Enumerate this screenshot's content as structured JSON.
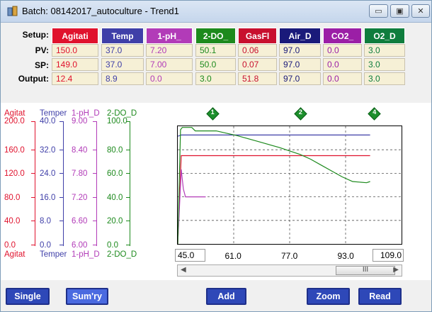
{
  "window": {
    "title": "Batch: 08142017_autoculture - Trend1"
  },
  "setup": {
    "row_labels": {
      "setup": "Setup:",
      "pv": "PV:",
      "sp": "SP:",
      "output": "Output:"
    },
    "columns": [
      {
        "label": "Agitati",
        "color": "#e0122d",
        "pv": "150.0",
        "sp": "149.0",
        "output": "12.4"
      },
      {
        "label": "Temp",
        "color": "#3f3fa8",
        "pv": "37.0",
        "sp": "37.0",
        "output": "8.9"
      },
      {
        "label": "1-pH_",
        "color": "#b23bb8",
        "pv": "7.20",
        "sp": "7.00",
        "output": "0.0"
      },
      {
        "label": "2-DO_",
        "color": "#1d8a1d",
        "pv": "50.1",
        "sp": "50.0",
        "output": "3.0"
      },
      {
        "label": "GasFl",
        "color": "#c8102e",
        "pv": "0.06",
        "sp": "0.07",
        "output": "51.8"
      },
      {
        "label": "Air_D",
        "color": "#1a1a7a",
        "pv": "97.0",
        "sp": "97.0",
        "output": "97.0"
      },
      {
        "label": "CO2_",
        "color": "#9b1fa6",
        "pv": "0.0",
        "sp": "0.0",
        "output": "0.0"
      },
      {
        "label": "O2_D",
        "color": "#0f7d3d",
        "pv": "3.0",
        "sp": "3.0",
        "output": "3.0"
      }
    ]
  },
  "chart_data": {
    "type": "line",
    "axes": [
      {
        "name": "Agitat",
        "color": "#e0122d",
        "ticks": [
          "200.0",
          "160.0",
          "120.0",
          "80.0",
          "40.0",
          "0.0"
        ],
        "ylim": [
          0,
          200
        ]
      },
      {
        "name": "Temper",
        "color": "#3f3fa8",
        "ticks": [
          "40.0",
          "32.0",
          "24.0",
          "16.0",
          "8.0",
          "0.0"
        ],
        "ylim": [
          0,
          40
        ]
      },
      {
        "name": "1-pH_D",
        "color": "#b23bb8",
        "ticks": [
          "9.00",
          "8.40",
          "7.80",
          "7.20",
          "6.60",
          "6.00"
        ],
        "ylim": [
          6,
          9
        ]
      },
      {
        "name": "2-DO_D",
        "color": "#1d8a1d",
        "ticks": [
          "100.0",
          "80.0",
          "60.0",
          "40.0",
          "20.0",
          "0.0"
        ],
        "ylim": [
          0,
          100
        ]
      }
    ],
    "x_ticks": [
      "45.0",
      "61.0",
      "77.0",
      "93.0",
      "109.0"
    ],
    "xlim": [
      45,
      109
    ],
    "markers": [
      {
        "label": "1",
        "x": 55
      },
      {
        "label": "2",
        "x": 80
      },
      {
        "label": "4",
        "x": 101
      }
    ],
    "series": [
      {
        "axis": "Agitat",
        "color": "#e0122d",
        "points": [
          [
            45,
            0
          ],
          [
            46,
            150
          ],
          [
            46.5,
            150
          ],
          [
            50,
            150
          ],
          [
            70,
            150
          ],
          [
            100,
            150
          ]
        ]
      },
      {
        "axis": "Temper",
        "color": "#3f3fa8",
        "points": [
          [
            45,
            36.6
          ],
          [
            46,
            37
          ],
          [
            100,
            37
          ]
        ]
      },
      {
        "axis": "1-pH_D",
        "color": "#b23bb8",
        "points": [
          [
            45,
            6
          ],
          [
            46,
            7.9
          ],
          [
            46.6,
            7.4
          ],
          [
            47.2,
            7.2
          ],
          [
            53,
            7.2
          ]
        ]
      },
      {
        "axis": "2-DO_D",
        "color": "#1d8a1d",
        "points": [
          [
            45,
            0
          ],
          [
            45.8,
            97
          ],
          [
            46.3,
            99
          ],
          [
            49,
            99
          ],
          [
            50,
            96
          ],
          [
            56,
            96
          ],
          [
            62,
            92
          ],
          [
            68,
            87
          ],
          [
            74,
            82
          ],
          [
            80,
            76
          ],
          [
            83,
            72
          ],
          [
            86,
            67
          ],
          [
            89,
            62
          ],
          [
            92,
            57
          ],
          [
            95,
            53
          ],
          [
            99,
            52
          ],
          [
            100,
            53
          ]
        ]
      }
    ]
  },
  "scrollbar": {
    "thumb_grip": "III"
  },
  "buttons": {
    "single": "Single",
    "summary": "Sum'ry",
    "add": "Add",
    "zoom": "Zoom",
    "read": "Read"
  },
  "controls": {
    "minimize": "▭",
    "maximize": "▣",
    "close": "✕"
  }
}
